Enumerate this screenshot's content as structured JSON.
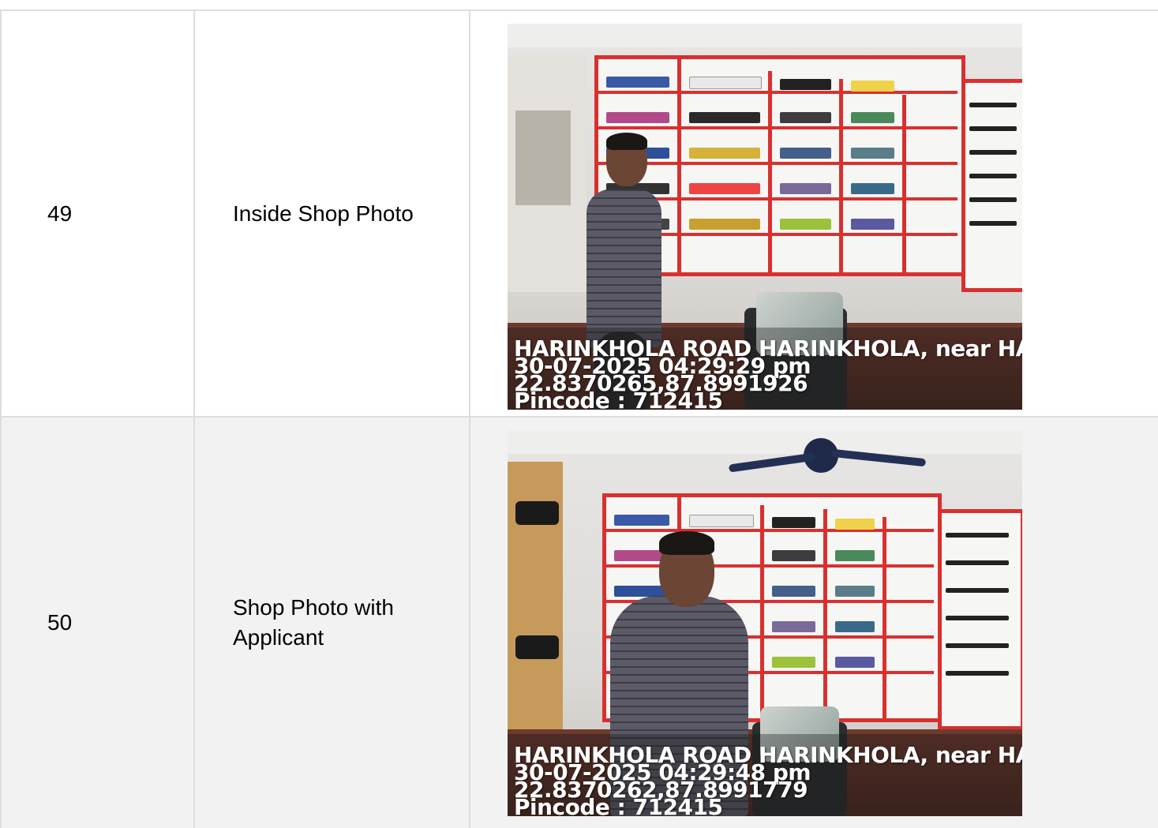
{
  "rows": [
    {
      "number": "49",
      "label": "Inside Shop Photo",
      "photo": {
        "overlay_lines": [
          "HARINKHOLA ROAD HARINKHOLA, near HA",
          "30-07-2025 04:29:29 pm",
          "22.8370265,87.8991926",
          "Pincode : 712415"
        ]
      }
    },
    {
      "number": "50",
      "label": "Shop Photo with Applicant",
      "photo": {
        "overlay_lines": [
          "HARINKHOLA ROAD HARINKHOLA, near HA",
          "30-07-2025 04:29:48 pm",
          "22.8370262,87.8991779",
          "Pincode : 712415"
        ]
      }
    }
  ],
  "colors": {
    "border": "#dddddd",
    "row_alt_background": "#f2f2f2",
    "shelf_red": "#d9302f"
  }
}
